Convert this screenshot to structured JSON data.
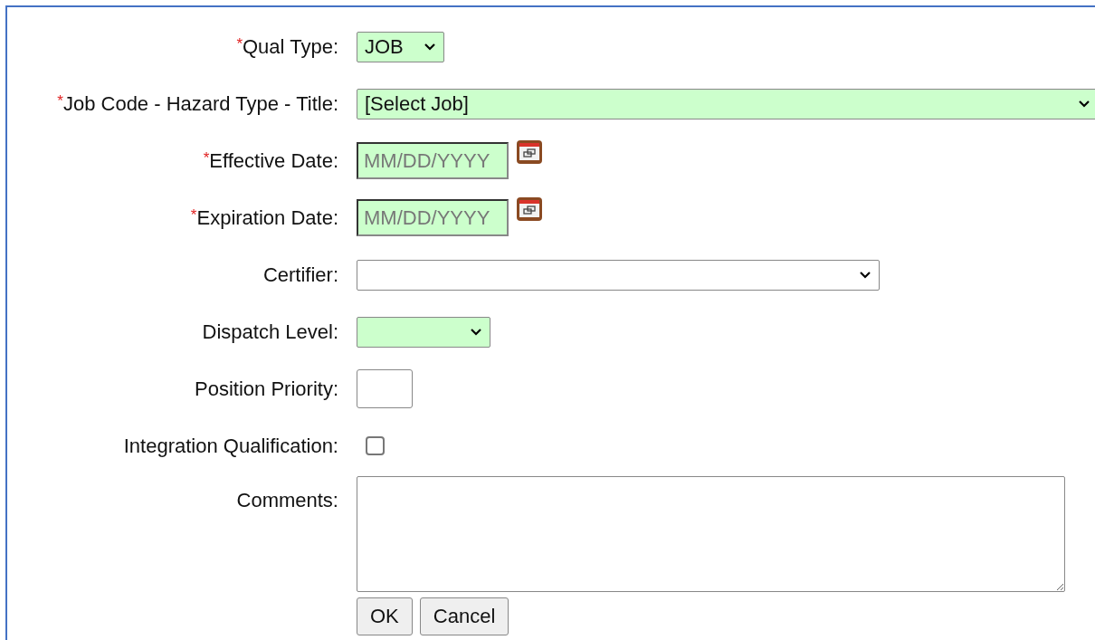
{
  "fields": [
    {
      "kind": "select",
      "marker": "*",
      "label": "Qual Type:",
      "value": "JOB",
      "highlighted": true
    },
    {
      "kind": "select",
      "marker": "*",
      "label": "Job Code - Hazard Type - Title:",
      "value": "[Select Job]",
      "highlighted": true
    },
    {
      "kind": "date",
      "marker": "*",
      "label": "Effective Date:",
      "placeholder": "MM/DD/YYYY",
      "highlighted": true
    },
    {
      "kind": "date",
      "marker": "*",
      "label": "Expiration Date:",
      "placeholder": "MM/DD/YYYY",
      "highlighted": true
    },
    {
      "kind": "select",
      "label": "Certifier:",
      "highlighted": false
    },
    {
      "kind": "select",
      "label": "Dispatch Level:",
      "highlighted": true
    },
    {
      "kind": "text",
      "label": "Position Priority:",
      "highlighted": false
    },
    {
      "kind": "checkbox",
      "label": "Integration Qualification:",
      "checked": false
    },
    {
      "kind": "textarea",
      "label": "Comments:",
      "highlighted": false
    }
  ],
  "buttons": [
    "OK",
    "Cancel"
  ]
}
